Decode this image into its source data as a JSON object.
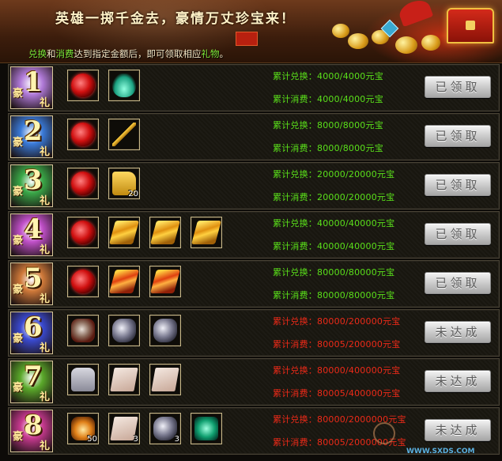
{
  "banner": {
    "title": "英雄一掷千金去，豪情万丈珍宝来！",
    "desc_part1": "兑换",
    "desc_part2": "和",
    "desc_part3": "消费",
    "desc_part4": "达到指定金额后，即可领取相应",
    "desc_part5": "礼物",
    "desc_part6": "。"
  },
  "rows": [
    {
      "num": "1",
      "char1": "豪",
      "char2": "礼",
      "color": "#b07ad8",
      "items": [
        {
          "icon": "orb",
          "count": ""
        },
        {
          "icon": "bottle",
          "count": ""
        }
      ],
      "exchange_label": "累计兑换：",
      "exchange_value": "4000/4000元宝",
      "spend_label": "累计消费：",
      "spend_value": "4000/4000元宝",
      "status": "done",
      "button": "已领取"
    },
    {
      "num": "2",
      "char1": "豪",
      "char2": "礼",
      "color": "#3a7ad8",
      "items": [
        {
          "icon": "orb",
          "count": ""
        },
        {
          "icon": "spear",
          "count": ""
        }
      ],
      "exchange_label": "累计兑换：",
      "exchange_value": "8000/8000元宝",
      "spend_label": "累计消费：",
      "spend_value": "8000/8000元宝",
      "status": "done",
      "button": "已领取"
    },
    {
      "num": "3",
      "char1": "豪",
      "char2": "礼",
      "color": "#3aa848",
      "items": [
        {
          "icon": "orb",
          "count": ""
        },
        {
          "icon": "bag",
          "count": "20"
        }
      ],
      "exchange_label": "累计兑换：",
      "exchange_value": "20000/20000元宝",
      "spend_label": "累计消费：",
      "spend_value": "20000/20000元宝",
      "status": "done",
      "button": "已领取"
    },
    {
      "num": "4",
      "char1": "豪",
      "char2": "礼",
      "color": "#c050c8",
      "items": [
        {
          "icon": "orb",
          "count": ""
        },
        {
          "icon": "scroll-gold",
          "count": ""
        },
        {
          "icon": "scroll-gold",
          "count": ""
        },
        {
          "icon": "scroll-gold",
          "count": ""
        }
      ],
      "exchange_label": "累计兑换：",
      "exchange_value": "40000/40000元宝",
      "spend_label": "累计消费：",
      "spend_value": "40000/40000元宝",
      "status": "done",
      "button": "已领取"
    },
    {
      "num": "5",
      "char1": "豪",
      "char2": "礼",
      "color": "#d07a3a",
      "items": [
        {
          "icon": "orb",
          "count": ""
        },
        {
          "icon": "scroll-red",
          "count": ""
        },
        {
          "icon": "scroll-red",
          "count": ""
        }
      ],
      "exchange_label": "累计兑换：",
      "exchange_value": "80000/80000元宝",
      "spend_label": "累计消费：",
      "spend_value": "80000/80000元宝",
      "status": "done",
      "button": "已领取"
    },
    {
      "num": "6",
      "char1": "豪",
      "char2": "礼",
      "color": "#3a4ad0",
      "items": [
        {
          "icon": "beast",
          "count": ""
        },
        {
          "icon": "ore",
          "count": ""
        },
        {
          "icon": "ore",
          "count": ""
        }
      ],
      "exchange_label": "累计兑换：",
      "exchange_value": "80000/200000元宝",
      "spend_label": "累计消费：",
      "spend_value": "80005/200000元宝",
      "status": "pending",
      "button": "未达成"
    },
    {
      "num": "7",
      "char1": "豪",
      "char2": "礼",
      "color": "#5aa82a",
      "items": [
        {
          "icon": "armor",
          "count": ""
        },
        {
          "icon": "paper",
          "count": ""
        },
        {
          "icon": "paper",
          "count": ""
        }
      ],
      "exchange_label": "累计兑换：",
      "exchange_value": "80000/400000元宝",
      "spend_label": "累计消费：",
      "spend_value": "80005/400000元宝",
      "status": "pending",
      "button": "未达成"
    },
    {
      "num": "8",
      "char1": "豪",
      "char2": "礼",
      "color": "#c83a90",
      "items": [
        {
          "icon": "fire",
          "count": "50"
        },
        {
          "icon": "paper",
          "count": "3"
        },
        {
          "icon": "ore",
          "count": "3"
        },
        {
          "icon": "jade",
          "count": ""
        }
      ],
      "exchange_label": "累计兑换：",
      "exchange_value": "80000/2000000元宝",
      "spend_label": "累计消费：",
      "spend_value": "80005/2000000元宝",
      "status": "pending",
      "button": "未达成"
    }
  ],
  "watermark": {
    "url": "WWW.SXDS.COM"
  },
  "colors": {
    "done": "#5ae01a",
    "pending": "#ee2a18"
  }
}
